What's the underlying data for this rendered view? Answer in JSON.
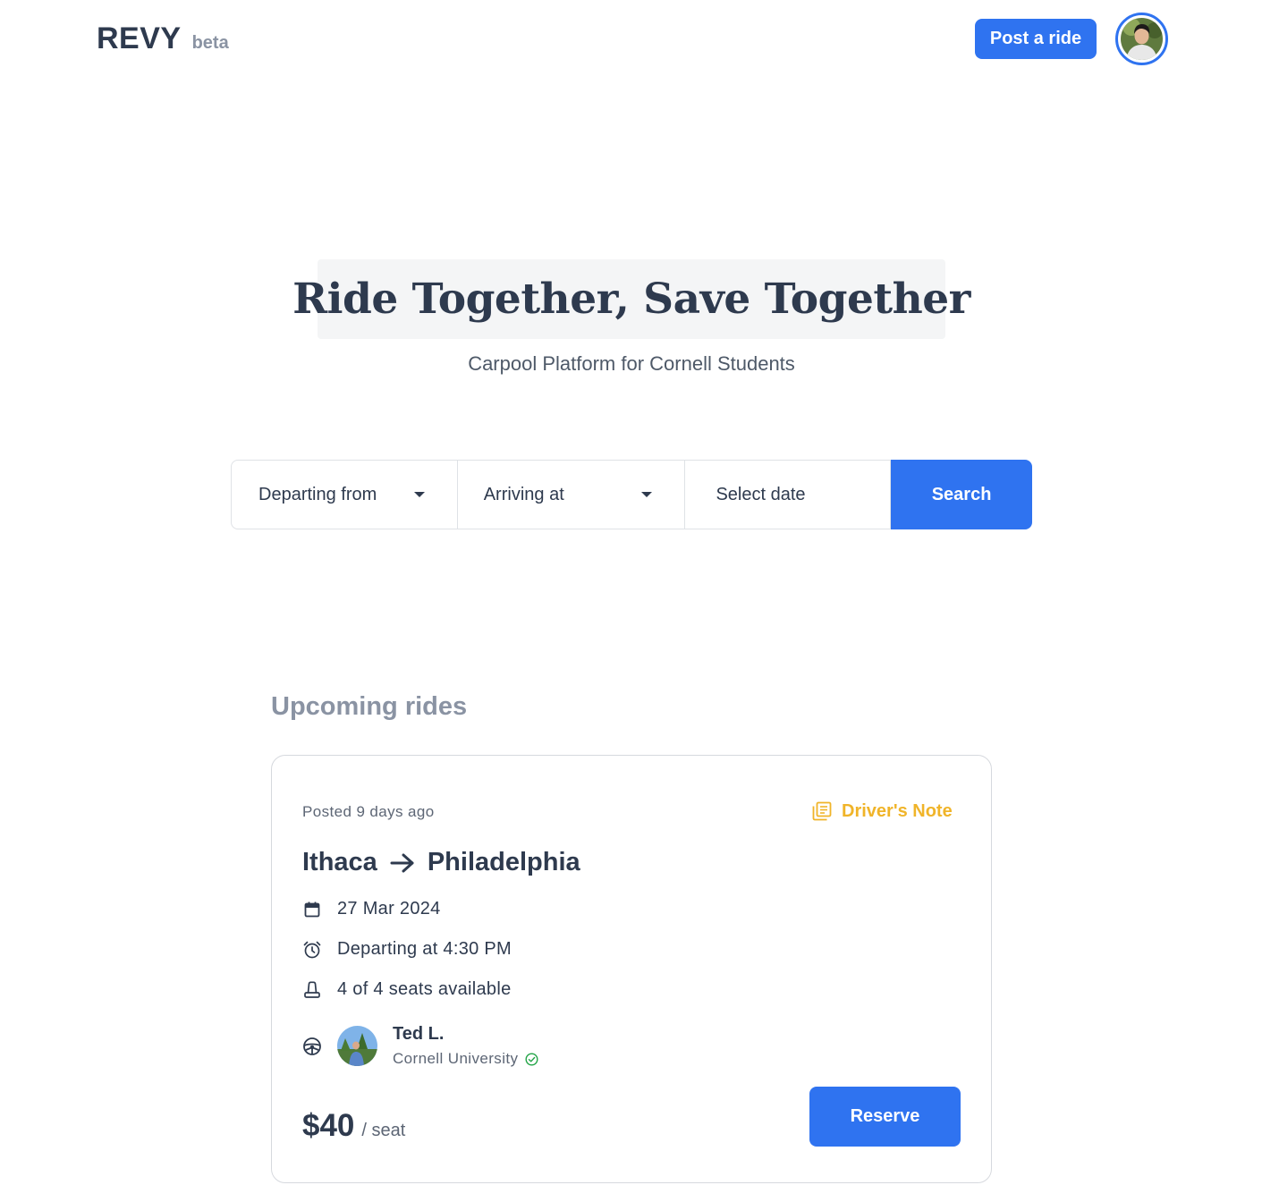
{
  "header": {
    "logo": "REVY",
    "logo_tag": "beta",
    "post_ride_label": "Post a ride"
  },
  "hero": {
    "title": "Ride Together, Save Together",
    "subtitle": "Carpool Platform for Cornell Students"
  },
  "search": {
    "departing_placeholder": "Departing from",
    "arriving_placeholder": "Arriving at",
    "date_placeholder": "Select date",
    "button_label": "Search"
  },
  "upcoming": {
    "title": "Upcoming rides",
    "rides": [
      {
        "posted": "Posted 9 days ago",
        "note_label": "Driver's Note",
        "from": "Ithaca",
        "to": "Philadelphia",
        "date": "27 Mar 2024",
        "departure": "Departing at 4:30 PM",
        "seats": "4 of 4 seats available",
        "driver_name": "Ted L.",
        "driver_school": "Cornell University",
        "price": "$40",
        "price_unit": "/ seat",
        "reserve_label": "Reserve"
      }
    ]
  },
  "colors": {
    "accent": "#2f73f0",
    "note": "#f0b429",
    "verified": "#22a447",
    "text": "#2e3a4e",
    "muted": "#8a93a3"
  },
  "icons": {
    "note": "note-icon",
    "arrow": "arrow-right-icon",
    "date": "calendar-icon",
    "time": "alarm-clock-icon",
    "seats": "seat-icon",
    "driver": "steering-wheel-icon",
    "verified": "verified-check-icon",
    "caret": "chevron-down-icon"
  }
}
